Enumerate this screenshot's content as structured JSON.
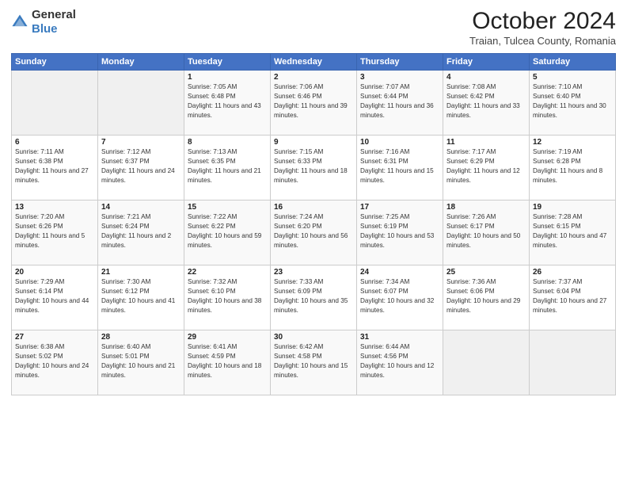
{
  "header": {
    "logo_general": "General",
    "logo_blue": "Blue",
    "month_title": "October 2024",
    "subtitle": "Traian, Tulcea County, Romania"
  },
  "days_of_week": [
    "Sunday",
    "Monday",
    "Tuesday",
    "Wednesday",
    "Thursday",
    "Friday",
    "Saturday"
  ],
  "weeks": [
    [
      {
        "day": "",
        "content": ""
      },
      {
        "day": "",
        "content": ""
      },
      {
        "day": "1",
        "content": "Sunrise: 7:05 AM\nSunset: 6:48 PM\nDaylight: 11 hours and 43 minutes."
      },
      {
        "day": "2",
        "content": "Sunrise: 7:06 AM\nSunset: 6:46 PM\nDaylight: 11 hours and 39 minutes."
      },
      {
        "day": "3",
        "content": "Sunrise: 7:07 AM\nSunset: 6:44 PM\nDaylight: 11 hours and 36 minutes."
      },
      {
        "day": "4",
        "content": "Sunrise: 7:08 AM\nSunset: 6:42 PM\nDaylight: 11 hours and 33 minutes."
      },
      {
        "day": "5",
        "content": "Sunrise: 7:10 AM\nSunset: 6:40 PM\nDaylight: 11 hours and 30 minutes."
      }
    ],
    [
      {
        "day": "6",
        "content": "Sunrise: 7:11 AM\nSunset: 6:38 PM\nDaylight: 11 hours and 27 minutes."
      },
      {
        "day": "7",
        "content": "Sunrise: 7:12 AM\nSunset: 6:37 PM\nDaylight: 11 hours and 24 minutes."
      },
      {
        "day": "8",
        "content": "Sunrise: 7:13 AM\nSunset: 6:35 PM\nDaylight: 11 hours and 21 minutes."
      },
      {
        "day": "9",
        "content": "Sunrise: 7:15 AM\nSunset: 6:33 PM\nDaylight: 11 hours and 18 minutes."
      },
      {
        "day": "10",
        "content": "Sunrise: 7:16 AM\nSunset: 6:31 PM\nDaylight: 11 hours and 15 minutes."
      },
      {
        "day": "11",
        "content": "Sunrise: 7:17 AM\nSunset: 6:29 PM\nDaylight: 11 hours and 12 minutes."
      },
      {
        "day": "12",
        "content": "Sunrise: 7:19 AM\nSunset: 6:28 PM\nDaylight: 11 hours and 8 minutes."
      }
    ],
    [
      {
        "day": "13",
        "content": "Sunrise: 7:20 AM\nSunset: 6:26 PM\nDaylight: 11 hours and 5 minutes."
      },
      {
        "day": "14",
        "content": "Sunrise: 7:21 AM\nSunset: 6:24 PM\nDaylight: 11 hours and 2 minutes."
      },
      {
        "day": "15",
        "content": "Sunrise: 7:22 AM\nSunset: 6:22 PM\nDaylight: 10 hours and 59 minutes."
      },
      {
        "day": "16",
        "content": "Sunrise: 7:24 AM\nSunset: 6:20 PM\nDaylight: 10 hours and 56 minutes."
      },
      {
        "day": "17",
        "content": "Sunrise: 7:25 AM\nSunset: 6:19 PM\nDaylight: 10 hours and 53 minutes."
      },
      {
        "day": "18",
        "content": "Sunrise: 7:26 AM\nSunset: 6:17 PM\nDaylight: 10 hours and 50 minutes."
      },
      {
        "day": "19",
        "content": "Sunrise: 7:28 AM\nSunset: 6:15 PM\nDaylight: 10 hours and 47 minutes."
      }
    ],
    [
      {
        "day": "20",
        "content": "Sunrise: 7:29 AM\nSunset: 6:14 PM\nDaylight: 10 hours and 44 minutes."
      },
      {
        "day": "21",
        "content": "Sunrise: 7:30 AM\nSunset: 6:12 PM\nDaylight: 10 hours and 41 minutes."
      },
      {
        "day": "22",
        "content": "Sunrise: 7:32 AM\nSunset: 6:10 PM\nDaylight: 10 hours and 38 minutes."
      },
      {
        "day": "23",
        "content": "Sunrise: 7:33 AM\nSunset: 6:09 PM\nDaylight: 10 hours and 35 minutes."
      },
      {
        "day": "24",
        "content": "Sunrise: 7:34 AM\nSunset: 6:07 PM\nDaylight: 10 hours and 32 minutes."
      },
      {
        "day": "25",
        "content": "Sunrise: 7:36 AM\nSunset: 6:06 PM\nDaylight: 10 hours and 29 minutes."
      },
      {
        "day": "26",
        "content": "Sunrise: 7:37 AM\nSunset: 6:04 PM\nDaylight: 10 hours and 27 minutes."
      }
    ],
    [
      {
        "day": "27",
        "content": "Sunrise: 6:38 AM\nSunset: 5:02 PM\nDaylight: 10 hours and 24 minutes."
      },
      {
        "day": "28",
        "content": "Sunrise: 6:40 AM\nSunset: 5:01 PM\nDaylight: 10 hours and 21 minutes."
      },
      {
        "day": "29",
        "content": "Sunrise: 6:41 AM\nSunset: 4:59 PM\nDaylight: 10 hours and 18 minutes."
      },
      {
        "day": "30",
        "content": "Sunrise: 6:42 AM\nSunset: 4:58 PM\nDaylight: 10 hours and 15 minutes."
      },
      {
        "day": "31",
        "content": "Sunrise: 6:44 AM\nSunset: 4:56 PM\nDaylight: 10 hours and 12 minutes."
      },
      {
        "day": "",
        "content": ""
      },
      {
        "day": "",
        "content": ""
      }
    ]
  ]
}
